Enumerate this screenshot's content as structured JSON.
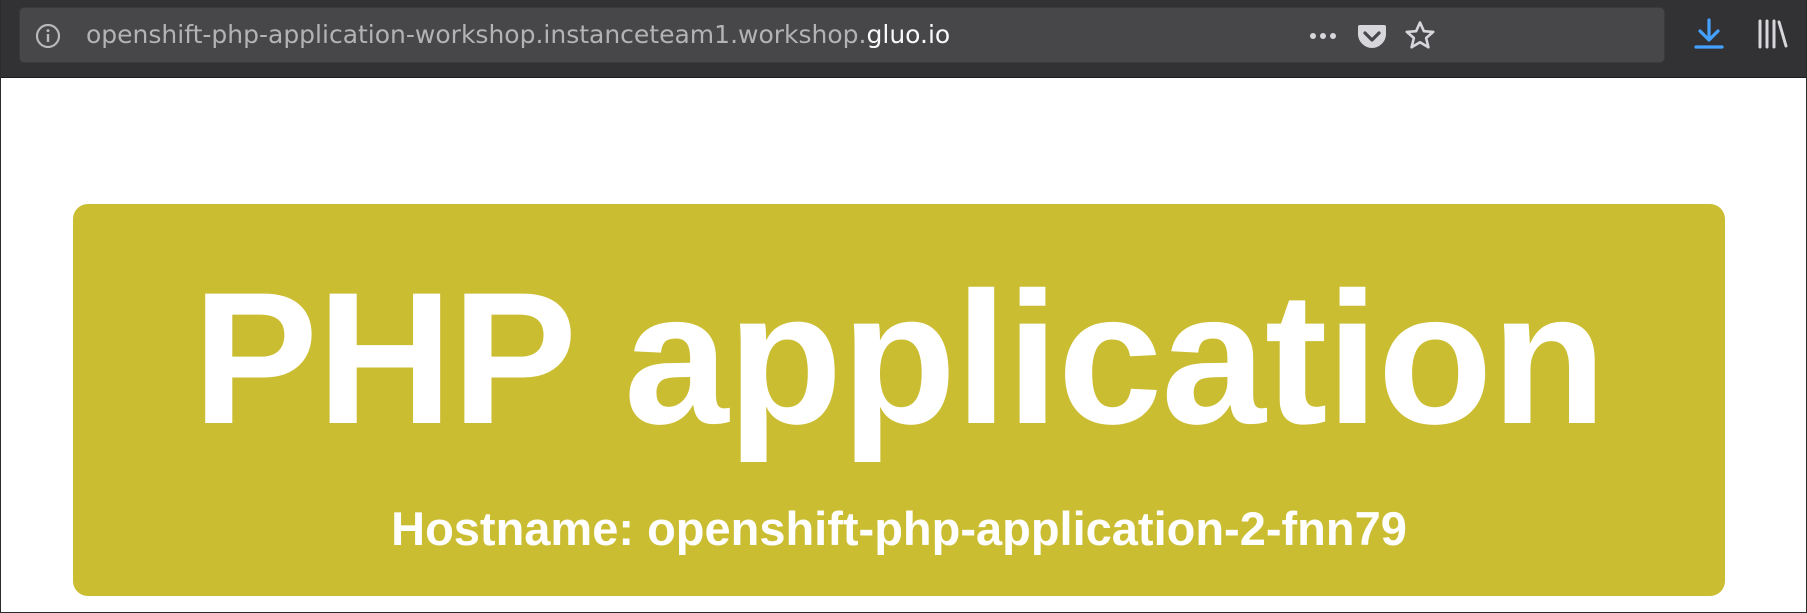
{
  "browser": {
    "url_prefix": "openshift-php-application-workshop.instanceteam1.workshop.",
    "url_domain": "gluo.io",
    "icons": {
      "site_info": "info-icon",
      "page_actions": "more-horizontal-icon",
      "pocket": "pocket-icon",
      "bookmark": "star-icon",
      "downloads": "download-arrow-icon",
      "library": "library-icon"
    },
    "colors": {
      "toolbar": "#323234",
      "urlbar": "#474749",
      "download_accent": "#45a1ff"
    }
  },
  "page": {
    "title": "PHP application",
    "hostname_label": "Hostname: openshift-php-application-2-fnn79",
    "colors": {
      "jumbotron": "#cbbd32",
      "text": "#ffffff"
    }
  }
}
